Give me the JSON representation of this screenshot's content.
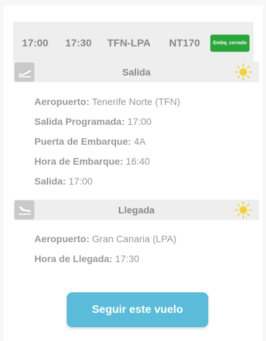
{
  "summary": {
    "departure_time": "17:00",
    "arrival_time": "17:30",
    "route": "TFN-LPA",
    "flight_number": "NT170",
    "status": "Embq. cerrado",
    "status_color": "#2aa539"
  },
  "departure": {
    "title": "Salida",
    "icon": "plane-takeoff-icon",
    "weather_icon": "sun-icon",
    "fields": [
      {
        "label": "Aeropuerto:",
        "value": "Tenerife Norte (TFN)"
      },
      {
        "label": "Salida Programada:",
        "value": "17:00"
      },
      {
        "label": "Puerta de Embarque:",
        "value": "4A"
      },
      {
        "label": "Hora de Embarque:",
        "value": "16:40"
      },
      {
        "label": "Salida:",
        "value": "17:00"
      }
    ]
  },
  "arrival": {
    "title": "Llegada",
    "icon": "plane-landing-icon",
    "weather_icon": "sun-icon",
    "fields": [
      {
        "label": "Aeropuerto:",
        "value": "Gran Canaria (LPA)"
      },
      {
        "label": "Hora de Llegada:",
        "value": "17:30"
      }
    ]
  },
  "follow_button": {
    "label": "Seguir este vuelo",
    "color": "#5bbcd9"
  }
}
